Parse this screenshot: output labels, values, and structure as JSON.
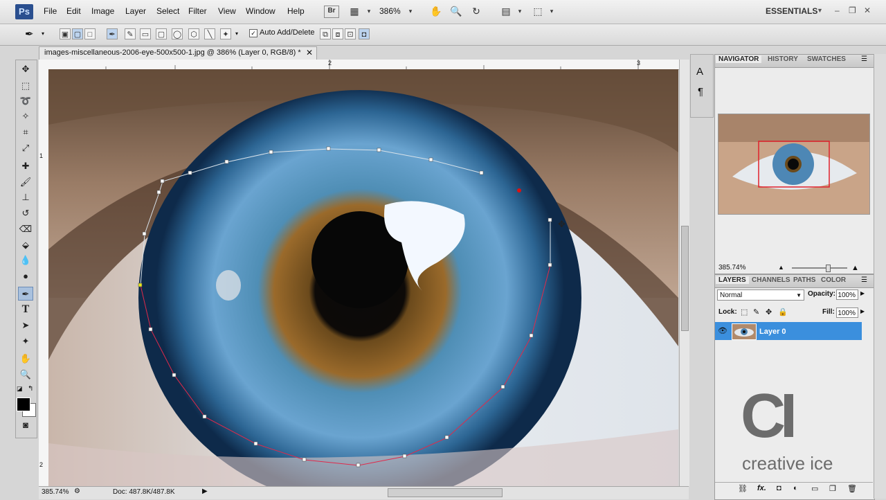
{
  "app": {
    "logo": "Ps"
  },
  "menu": [
    "File",
    "Edit",
    "Image",
    "Layer",
    "Select",
    "Filter",
    "View",
    "Window",
    "Help"
  ],
  "app_bar": {
    "bridge_label": "Br",
    "zoom": "386%",
    "workspace": "ESSENTIALS"
  },
  "options_bar": {
    "auto_add_delete": "Auto Add/Delete",
    "auto_add_checked": true
  },
  "document": {
    "tab_title": "images-miscellaneous-2006-eye-500x500-1.jpg @ 386% (Layer 0, RGB/8) *",
    "ruler_top": [
      "2",
      "3"
    ],
    "ruler_left": [
      "1",
      "2"
    ]
  },
  "status": {
    "zoom": "385.74%",
    "doc": "Doc: 487.8K/487.8K"
  },
  "navigator": {
    "tabs": [
      "NAVIGATOR",
      "HISTORY",
      "SWATCHES"
    ],
    "zoom": "385.74%"
  },
  "layers": {
    "tabs": [
      "LAYERS",
      "CHANNELS",
      "PATHS",
      "COLOR"
    ],
    "blend_mode": "Normal",
    "opacity_label": "Opacity:",
    "opacity": "100%",
    "lock_label": "Lock:",
    "fill_label": "Fill:",
    "fill": "100%",
    "layer_name": "Layer 0"
  },
  "watermark": {
    "mark": "CI",
    "text": "creative ice"
  },
  "colors": {
    "accent": "#3b8fdd",
    "path": "#e0294a",
    "anchor": "#e8e81a"
  }
}
